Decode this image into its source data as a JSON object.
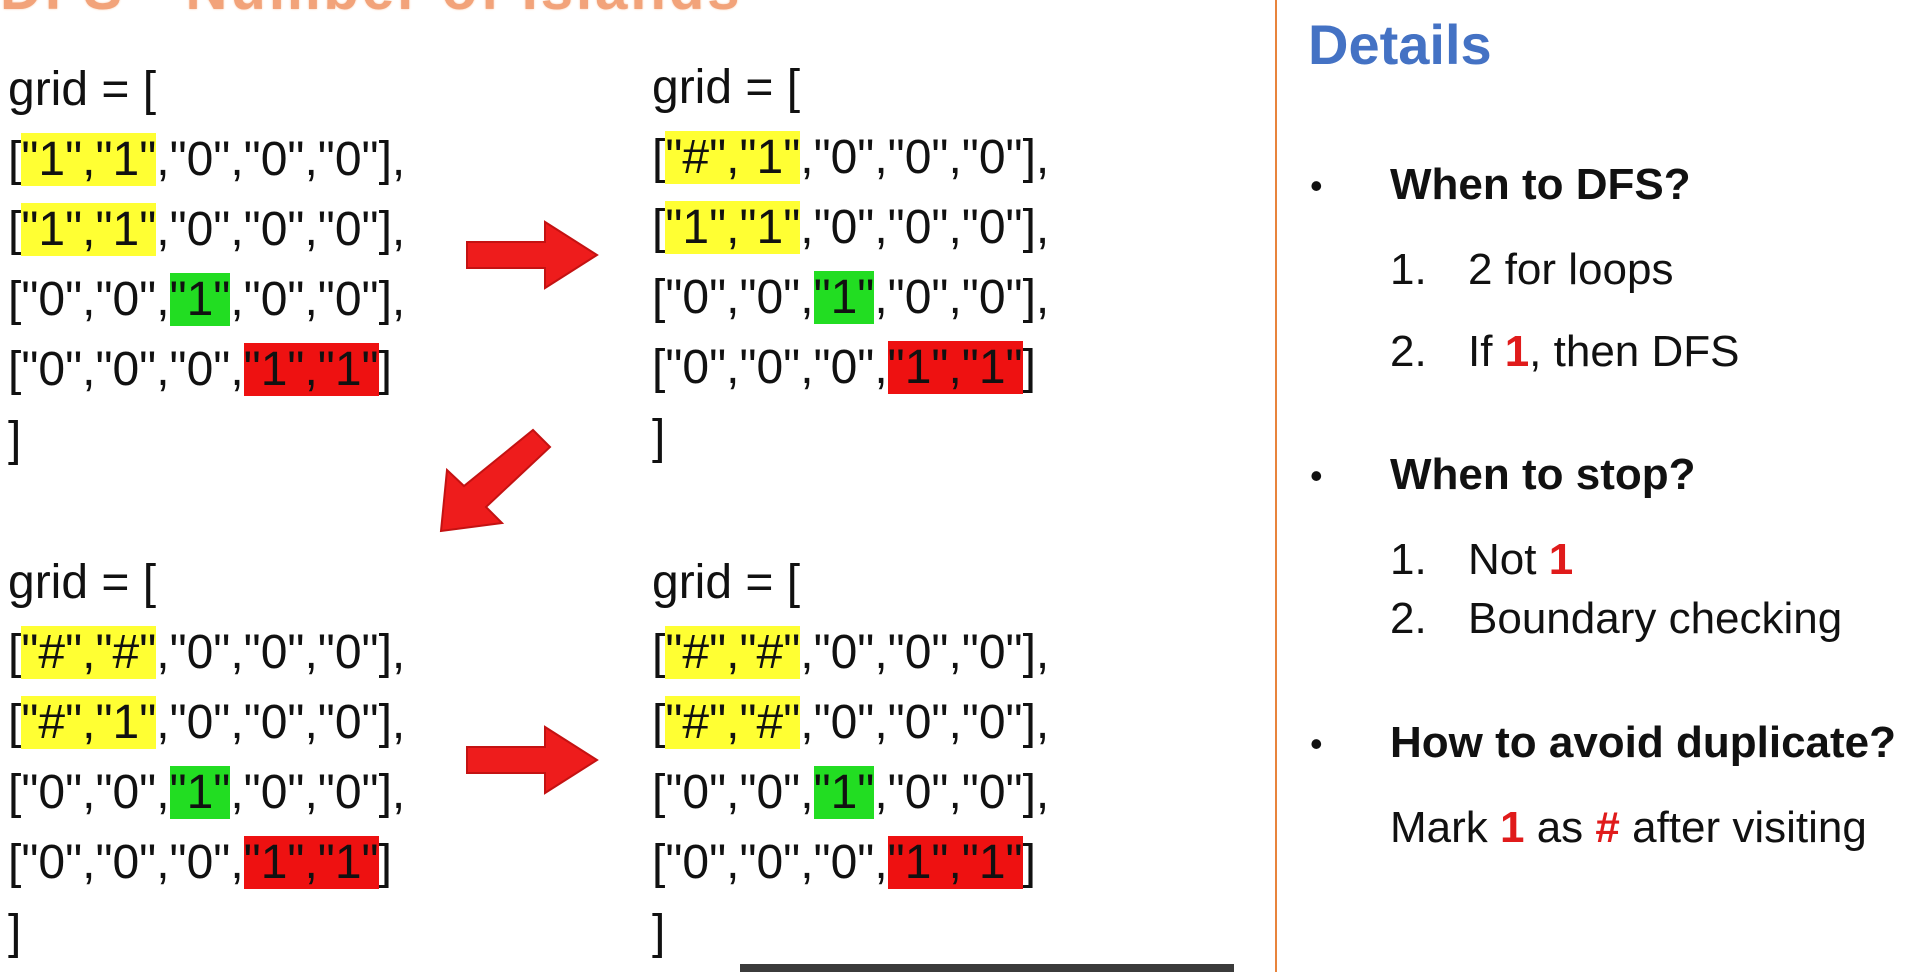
{
  "top_title": "DFS - Number of Islands",
  "grids": [
    {
      "header": "grid = [",
      "rows": [
        [
          {
            "text": "[",
            "hl": ""
          },
          {
            "text": "\"1\",\"1\"",
            "hl": "yellow"
          },
          {
            "text": ",\"0\",\"0\",\"0\"],",
            "hl": ""
          }
        ],
        [
          {
            "text": "[",
            "hl": ""
          },
          {
            "text": "\"1\",\"1\"",
            "hl": "yellow"
          },
          {
            "text": ",\"0\",\"0\",\"0\"],",
            "hl": ""
          }
        ],
        [
          {
            "text": "[\"0\",\"0\",",
            "hl": ""
          },
          {
            "text": "\"1\"",
            "hl": "green"
          },
          {
            "text": ",\"0\",\"0\"],",
            "hl": ""
          }
        ],
        [
          {
            "text": "[\"0\",\"0\",\"0\",",
            "hl": ""
          },
          {
            "text": "\"1\",\"1\"",
            "hl": "red"
          },
          {
            "text": "]",
            "hl": ""
          }
        ]
      ],
      "footer": "]"
    },
    {
      "header": "grid = [",
      "rows": [
        [
          {
            "text": "[",
            "hl": ""
          },
          {
            "text": "\"#\",\"1\"",
            "hl": "yellow"
          },
          {
            "text": ",\"0\",\"0\",\"0\"],",
            "hl": ""
          }
        ],
        [
          {
            "text": "[",
            "hl": ""
          },
          {
            "text": "\"1\",\"1\"",
            "hl": "yellow"
          },
          {
            "text": ",\"0\",\"0\",\"0\"],",
            "hl": ""
          }
        ],
        [
          {
            "text": "[\"0\",\"0\",",
            "hl": ""
          },
          {
            "text": "\"1\"",
            "hl": "green"
          },
          {
            "text": ",\"0\",\"0\"],",
            "hl": ""
          }
        ],
        [
          {
            "text": "[\"0\",\"0\",\"0\",",
            "hl": ""
          },
          {
            "text": "\"1\",\"1\"",
            "hl": "red"
          },
          {
            "text": "]",
            "hl": ""
          }
        ]
      ],
      "footer": "]"
    },
    {
      "header": "grid = [",
      "rows": [
        [
          {
            "text": "[",
            "hl": ""
          },
          {
            "text": "\"#\",\"#\"",
            "hl": "yellow"
          },
          {
            "text": ",\"0\",\"0\",\"0\"],",
            "hl": ""
          }
        ],
        [
          {
            "text": "[",
            "hl": ""
          },
          {
            "text": "\"#\",\"1\"",
            "hl": "yellow"
          },
          {
            "text": ",\"0\",\"0\",\"0\"],",
            "hl": ""
          }
        ],
        [
          {
            "text": "[\"0\",\"0\",",
            "hl": ""
          },
          {
            "text": "\"1\"",
            "hl": "green"
          },
          {
            "text": ",\"0\",\"0\"],",
            "hl": ""
          }
        ],
        [
          {
            "text": "[\"0\",\"0\",\"0\",",
            "hl": ""
          },
          {
            "text": "\"1\",\"1\"",
            "hl": "red"
          },
          {
            "text": "]",
            "hl": ""
          }
        ]
      ],
      "footer": "]"
    },
    {
      "header": "grid = [",
      "rows": [
        [
          {
            "text": "[",
            "hl": ""
          },
          {
            "text": "\"#\",\"#\"",
            "hl": "yellow"
          },
          {
            "text": ",\"0\",\"0\",\"0\"],",
            "hl": ""
          }
        ],
        [
          {
            "text": "[",
            "hl": ""
          },
          {
            "text": "\"#\",\"#\"",
            "hl": "yellow"
          },
          {
            "text": ",\"0\",\"0\",\"0\"],",
            "hl": ""
          }
        ],
        [
          {
            "text": "[\"0\",\"0\",",
            "hl": ""
          },
          {
            "text": "\"1\"",
            "hl": "green"
          },
          {
            "text": ",\"0\",\"0\"],",
            "hl": ""
          }
        ],
        [
          {
            "text": "[\"0\",\"0\",\"0\",",
            "hl": ""
          },
          {
            "text": "\"1\",\"1\"",
            "hl": "red"
          },
          {
            "text": "]",
            "hl": ""
          }
        ]
      ],
      "footer": "]"
    }
  ],
  "details": {
    "title": "Details",
    "sections": [
      {
        "bullet": "•",
        "heading": "When to DFS?",
        "items": [
          {
            "num": "1.",
            "parts": [
              {
                "text": "2 for loops",
                "red": false
              }
            ]
          },
          {
            "num": "2.",
            "parts": [
              {
                "text": "If ",
                "red": false
              },
              {
                "text": "1",
                "red": true
              },
              {
                "text": ", then DFS",
                "red": false
              }
            ]
          }
        ]
      },
      {
        "bullet": "•",
        "heading": "When to stop?",
        "items": [
          {
            "num": "1.",
            "parts": [
              {
                "text": "Not ",
                "red": false
              },
              {
                "text": "1",
                "red": true
              }
            ]
          },
          {
            "num": "2.",
            "parts": [
              {
                "text": "Boundary checking",
                "red": false
              }
            ]
          }
        ]
      },
      {
        "bullet": "•",
        "heading": "How to avoid duplicate?",
        "items": [
          {
            "num": "",
            "parts": [
              {
                "text": "Mark ",
                "red": false
              },
              {
                "text": "1",
                "red": true
              },
              {
                "text": " as ",
                "red": false
              },
              {
                "text": "#",
                "red": true
              },
              {
                "text": " after visiting",
                "red": false
              }
            ]
          }
        ]
      }
    ]
  },
  "colors": {
    "highlight_yellow": "#ffff33",
    "highlight_green": "#22dd22",
    "highlight_red": "#ee1111",
    "arrow": "#ee1c1c",
    "divider": "#e8843c",
    "details_title": "#4472c4",
    "emphasis_red": "#e01b1b"
  }
}
